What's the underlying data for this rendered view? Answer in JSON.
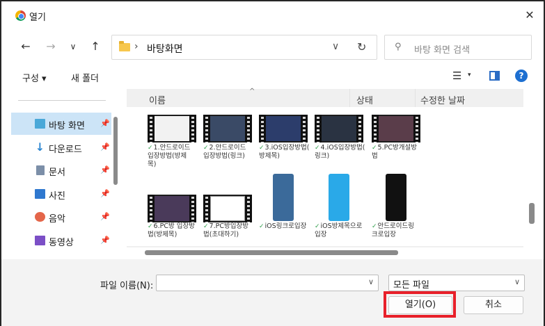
{
  "window": {
    "title": "열기",
    "close_glyph": "✕"
  },
  "nav": {
    "back_glyph": "←",
    "forward_glyph": "→",
    "recent_glyph": "∨",
    "up_glyph": "↑",
    "address_separator": "›",
    "address_path": "바탕화면",
    "address_dropdown_glyph": "∨",
    "refresh_glyph": "↻",
    "search_placeholder": "바탕 화면 검색"
  },
  "toolbar": {
    "organize": "구성 ▾",
    "new_folder": "새 폴더"
  },
  "sidebar": {
    "items": [
      {
        "label": "바탕 화면",
        "icon": "desktop-icon",
        "selected": true
      },
      {
        "label": "다운로드",
        "icon": "download-icon"
      },
      {
        "label": "문서",
        "icon": "document-icon"
      },
      {
        "label": "사진",
        "icon": "pictures-icon"
      },
      {
        "label": "음악",
        "icon": "music-icon"
      },
      {
        "label": "동영상",
        "icon": "videos-icon"
      }
    ],
    "pin_glyph": "📌"
  },
  "columns": {
    "name": "이름",
    "status": "상태",
    "modified": "수정한 날짜"
  },
  "files": [
    {
      "line1": "1.안드로이드",
      "line2": "입장방법(방제",
      "line3": "목)",
      "kind": "video",
      "frame": "#f2f2f2"
    },
    {
      "line1": "2.안드로이드",
      "line2": "입장방법(링크)",
      "line3": "",
      "kind": "video",
      "frame": "#3a4a66"
    },
    {
      "line1": "3.iOS입장방법(",
      "line2": "방제목)",
      "line3": "",
      "kind": "video",
      "frame": "#2c3d6b"
    },
    {
      "line1": "4.iOS입장방법(",
      "line2": "링크)",
      "line3": "",
      "kind": "video",
      "frame": "#2a3342"
    },
    {
      "line1": "5.PC방개설방",
      "line2": "법",
      "line3": "",
      "kind": "video",
      "frame": "#5a3d4a"
    },
    {
      "line1": "6.PC방 입장방",
      "line2": "법(방제목)",
      "line3": "",
      "kind": "video",
      "frame": "#4a3a5a"
    },
    {
      "line1": "7.PC방입장방",
      "line2": "법(초대하기)",
      "line3": "",
      "kind": "video-light",
      "frame": "#ffffff"
    },
    {
      "line1": "iOS링크로입장",
      "line2": "",
      "line3": "",
      "kind": "phone",
      "frame": "#3b6a9a"
    },
    {
      "line1": "iOS방제목으로",
      "line2": "입장",
      "line3": "",
      "kind": "phone",
      "frame": "#2aa9e8"
    },
    {
      "line1": "안드로이드링",
      "line2": "크로입장",
      "line3": "",
      "kind": "phone",
      "frame": "#111111"
    }
  ],
  "footer": {
    "filename_label": "파일 이름(N):",
    "filename_value": "",
    "filetype_value": "모든 파일",
    "open_label": "열기(O)",
    "cancel_label": "취소",
    "dropdown_glyph": "∨"
  },
  "colors": {
    "selection": "#cce4f7",
    "highlight": "#e8202a",
    "sync_check": "#2e9d4a"
  }
}
